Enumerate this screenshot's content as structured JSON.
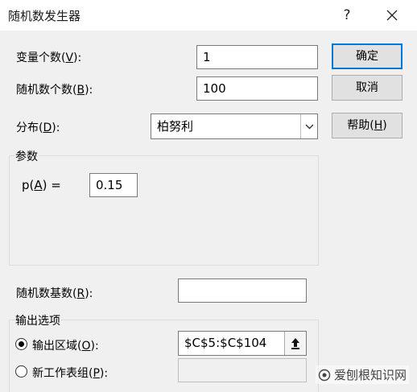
{
  "window": {
    "title": "随机数发生器",
    "help_icon": "question-icon",
    "close_icon": "close-icon"
  },
  "fields": {
    "num_variables": {
      "label_pre": "变量个数(",
      "mnemonic": "V",
      "label_post": "):",
      "value": "1"
    },
    "num_random": {
      "label_pre": "随机数个数(",
      "mnemonic": "B",
      "label_post": "):",
      "value": "100"
    },
    "distribution": {
      "label_pre": "分布(",
      "mnemonic": "D",
      "label_post": "):",
      "value": "柏努利"
    }
  },
  "parameters": {
    "group_label": "参数",
    "p_label_pre": "p(",
    "p_mnemonic": "A",
    "p_label_post": ") =",
    "p_value": "0.15"
  },
  "seed": {
    "label_pre": "随机数基数(",
    "mnemonic": "R",
    "label_post": "):",
    "value": ""
  },
  "output": {
    "group_label": "输出选项",
    "range": {
      "label_pre": "输出区域(",
      "mnemonic": "O",
      "label_post": "):",
      "value": "$C$5:$C$104",
      "selected": true
    },
    "new_sheet": {
      "label_pre": "新工作表组(",
      "mnemonic": "P",
      "label_post": "):",
      "value": "",
      "selected": false
    }
  },
  "buttons": {
    "ok": "确定",
    "cancel": "取消",
    "help_pre": "帮助(",
    "help_mnemonic": "H",
    "help_post": ")"
  },
  "watermark": {
    "text": "爱刨根知识网"
  },
  "colors": {
    "accent": "#0078d7",
    "dialog_bg": "#f0f0f0"
  }
}
